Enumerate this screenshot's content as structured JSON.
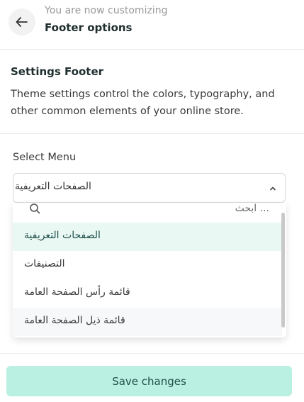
{
  "header": {
    "subtitle": "You are now customizing",
    "title": "Footer options"
  },
  "settings": {
    "title": "Settings Footer",
    "description": "Theme settings control the colors, typography, and other common elements of your online store."
  },
  "select_menu": {
    "label": "Select Menu",
    "selected_value": "الصفحات التعريفية",
    "search_placeholder": "... ابحث",
    "options": [
      {
        "label": "الصفحات التعريفية",
        "state": "selected"
      },
      {
        "label": "التصنيفات",
        "state": "normal"
      },
      {
        "label": "قائمة رأس الصفحة العامة",
        "state": "normal"
      },
      {
        "label": "قائمة ذيل الصفحة العامة",
        "state": "hovered"
      }
    ]
  },
  "footer": {
    "save_label": "Save changes"
  },
  "icons": {
    "back": "arrow-left-icon",
    "chevron": "chevron-up-icon",
    "search": "search-icon"
  },
  "colors": {
    "accent": "#baf0e2",
    "selected_bg": "#eaf8f4"
  }
}
